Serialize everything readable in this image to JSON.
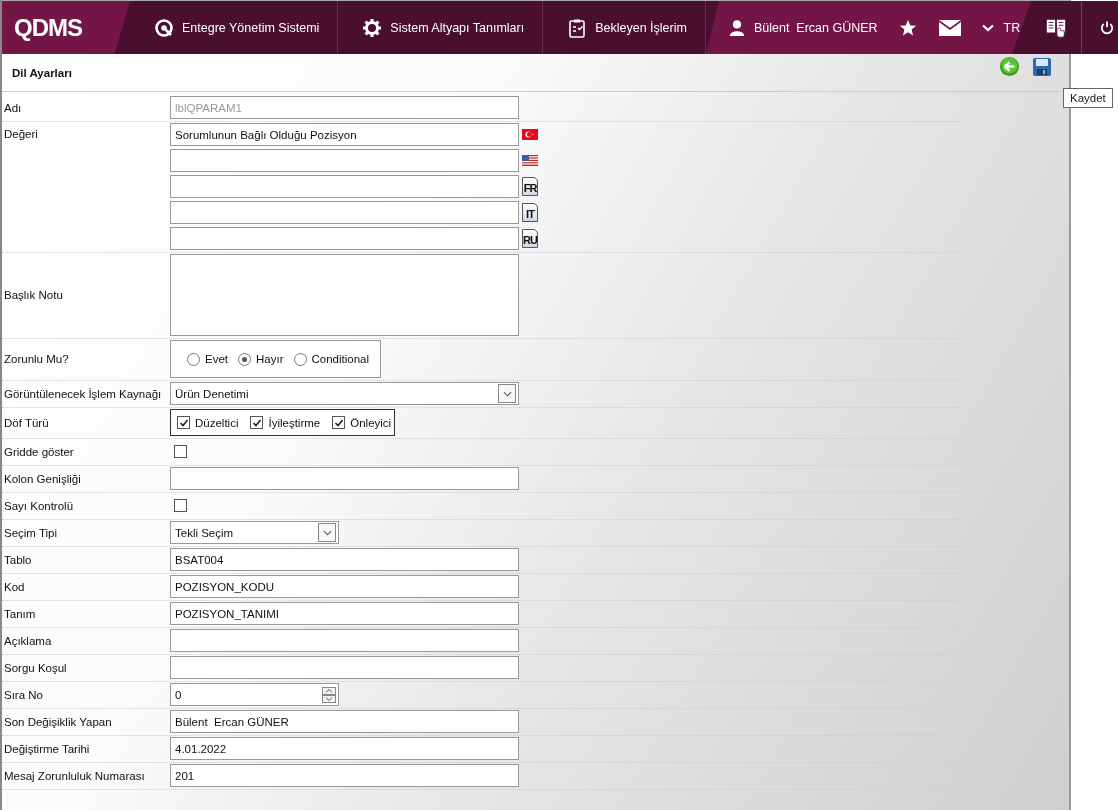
{
  "header": {
    "logo": "QDMS",
    "nav": [
      {
        "label": "Entegre Yönetim Sistemi"
      },
      {
        "label": "Sistem Altyapı Tanımları"
      },
      {
        "label": "Bekleyen İşlerim"
      }
    ],
    "user": "Bülent  Ercan GÜNER",
    "language": "TR"
  },
  "page": {
    "title": "Dil Ayarları",
    "save_tooltip": "Kaydet"
  },
  "rows": [
    {
      "kind": "text",
      "label": "Adı",
      "value": "lblQPARAM1",
      "disabled": true
    },
    {
      "kind": "lang",
      "label": "Değeri",
      "inputs": [
        {
          "kind": "flag",
          "value": "Sorumlunun Bağlı Olduğu Pozisyon"
        },
        {
          "kind": "flag"
        },
        {
          "kind": "doc",
          "code": "FR"
        },
        {
          "kind": "doc",
          "code": "IT"
        },
        {
          "kind": "doc",
          "code": "RU"
        }
      ]
    },
    {
      "kind": "textarea",
      "label": "Başlık Notu"
    },
    {
      "kind": "radio",
      "label": "Zorunlu Mu?",
      "options": [
        {
          "label": "Evet",
          "selected": false
        },
        {
          "label": "Hayır",
          "selected": true
        },
        {
          "label": "Conditional",
          "selected": false
        }
      ]
    },
    {
      "kind": "select",
      "label": "Görüntülenecek İşlem Kaynağı",
      "value": "Ürün Denetimi"
    },
    {
      "kind": "checks",
      "label": "Döf Türü",
      "options": [
        {
          "label": "Düzeltici",
          "checked": true
        },
        {
          "label": "İyileştirme",
          "checked": true
        },
        {
          "label": "Önleyici",
          "checked": true
        }
      ]
    },
    {
      "kind": "checkbox",
      "label": "Gridde göster",
      "checked": false
    },
    {
      "kind": "text",
      "label": "Kolon Genişliği"
    },
    {
      "kind": "checkbox",
      "label": "Sayı Kontrolü",
      "checked": false
    },
    {
      "kind": "short_select",
      "label": "Seçim Tipi",
      "value": "Tekli Seçim"
    },
    {
      "kind": "text",
      "label": "Tablo",
      "value": "BSAT004"
    },
    {
      "kind": "text",
      "label": "Kod",
      "value": "POZISYON_KODU"
    },
    {
      "kind": "text",
      "label": "Tanım",
      "value": "POZISYON_TANIMI"
    },
    {
      "kind": "text",
      "label": "Açıklama"
    },
    {
      "kind": "text",
      "label": "Sorgu Koşul"
    },
    {
      "kind": "number",
      "label": "Sıra No",
      "value": "0"
    },
    {
      "kind": "text",
      "label": "Son Değişiklik Yapan",
      "value": "Bülent  Ercan GÜNER"
    },
    {
      "kind": "text",
      "label": "Değiştirme Tarihi",
      "value": "4.01.2022"
    },
    {
      "kind": "text",
      "label": "Mesaj Zorunluluk Numarası",
      "value": "201"
    }
  ]
}
